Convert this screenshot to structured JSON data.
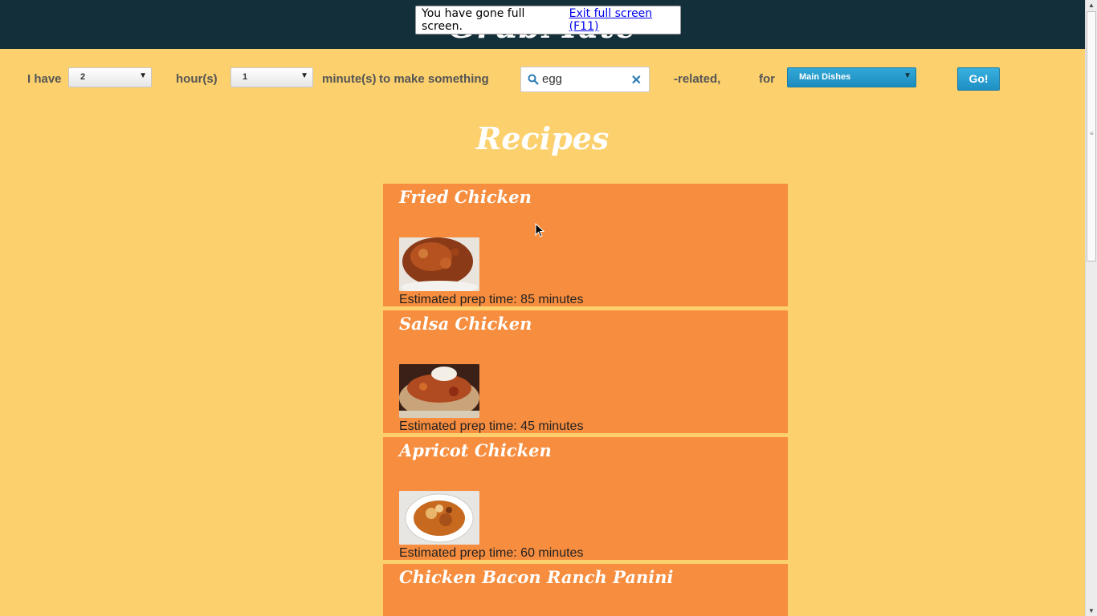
{
  "header": {
    "site_title": "GrubMate"
  },
  "fullscreen_notice": {
    "message": "You have gone full screen.",
    "exit_link": "Exit full screen (F11)"
  },
  "form": {
    "i_have": "I have",
    "hours_value": "2",
    "hours_label": "hour(s)",
    "minutes_value": "1",
    "minutes_label": "minute(s)",
    "to_make": "to make something",
    "search_value": "egg",
    "related_label": "-related,",
    "for_label": "for",
    "category_value": "Main Dishes",
    "go_label": "Go!"
  },
  "section_heading": "Recipes",
  "recipes": [
    {
      "title": "Fried Chicken",
      "prep": "Estimated prep time: 85 minutes"
    },
    {
      "title": "Salsa Chicken",
      "prep": "Estimated prep time: 45 minutes"
    },
    {
      "title": "Apricot Chicken",
      "prep": "Estimated prep time: 60 minutes"
    },
    {
      "title": "Chicken Bacon Ranch Panini"
    }
  ],
  "colors": {
    "background": "#fbd06d",
    "header": "#13303a",
    "card": "#f78d3e",
    "button": "#2a9fd0"
  }
}
